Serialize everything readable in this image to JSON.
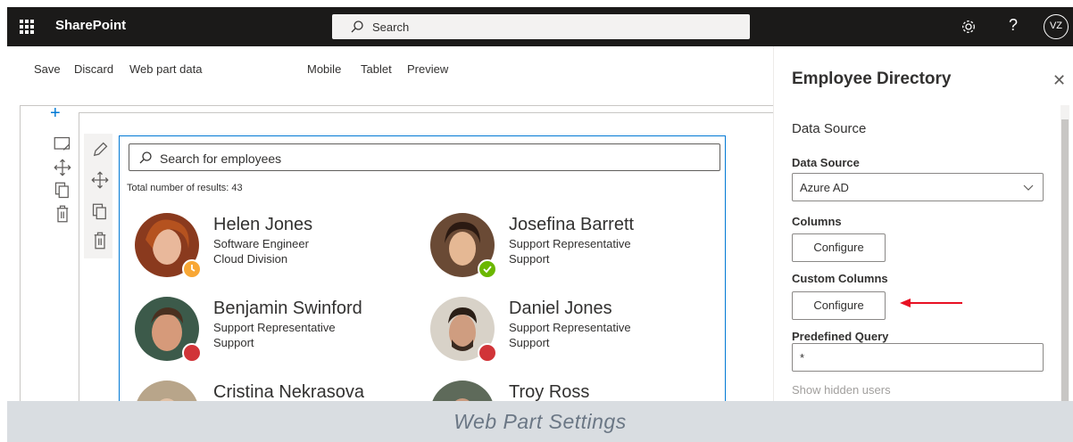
{
  "suite_bar": {
    "app_name": "SharePoint",
    "search_placeholder": "Search",
    "help_label": "?",
    "user_initials": "VZ"
  },
  "command_bar": {
    "save": "Save",
    "discard": "Discard",
    "web_part_data": "Web part data",
    "mobile": "Mobile",
    "tablet": "Tablet",
    "preview": "Preview"
  },
  "web_part": {
    "search_placeholder": "Search for employees",
    "total_results": "Total number of results: 43",
    "employees": [
      {
        "name": "Helen Jones",
        "title": "Software Engineer",
        "department": "Cloud Division",
        "presence": "away",
        "presence_color": "#f8a735"
      },
      {
        "name": "Josefina Barrett",
        "title": "Support Representative",
        "department": "Support",
        "presence": "available",
        "presence_color": "#6bb700"
      },
      {
        "name": "Benjamin Swinford",
        "title": "Support Representative",
        "department": "Support",
        "presence": "busy",
        "presence_color": "#d13438"
      },
      {
        "name": "Daniel Jones",
        "title": "Support Representative",
        "department": "Support",
        "presence": "busy",
        "presence_color": "#d13438"
      },
      {
        "name": "Cristina Nekrasova",
        "title": "",
        "department": "",
        "presence": "",
        "presence_color": ""
      },
      {
        "name": "Troy Ross",
        "title": "",
        "department": "",
        "presence": "",
        "presence_color": ""
      }
    ]
  },
  "property_pane": {
    "title": "Employee Directory",
    "group_name": "Data Source",
    "data_source_label": "Data Source",
    "data_source_value": "Azure AD",
    "columns_label": "Columns",
    "columns_button": "Configure",
    "custom_columns_label": "Custom Columns",
    "custom_columns_button": "Configure",
    "predefined_query_label": "Predefined Query",
    "predefined_query_value": "*",
    "show_hidden_users": "Show hidden users"
  },
  "caption": "Web Part Settings",
  "colors": {
    "suite_bar_bg": "#1b1a19",
    "accent": "#0078d4",
    "arrow": "#e81123",
    "caption_bg": "#d9dde1"
  }
}
